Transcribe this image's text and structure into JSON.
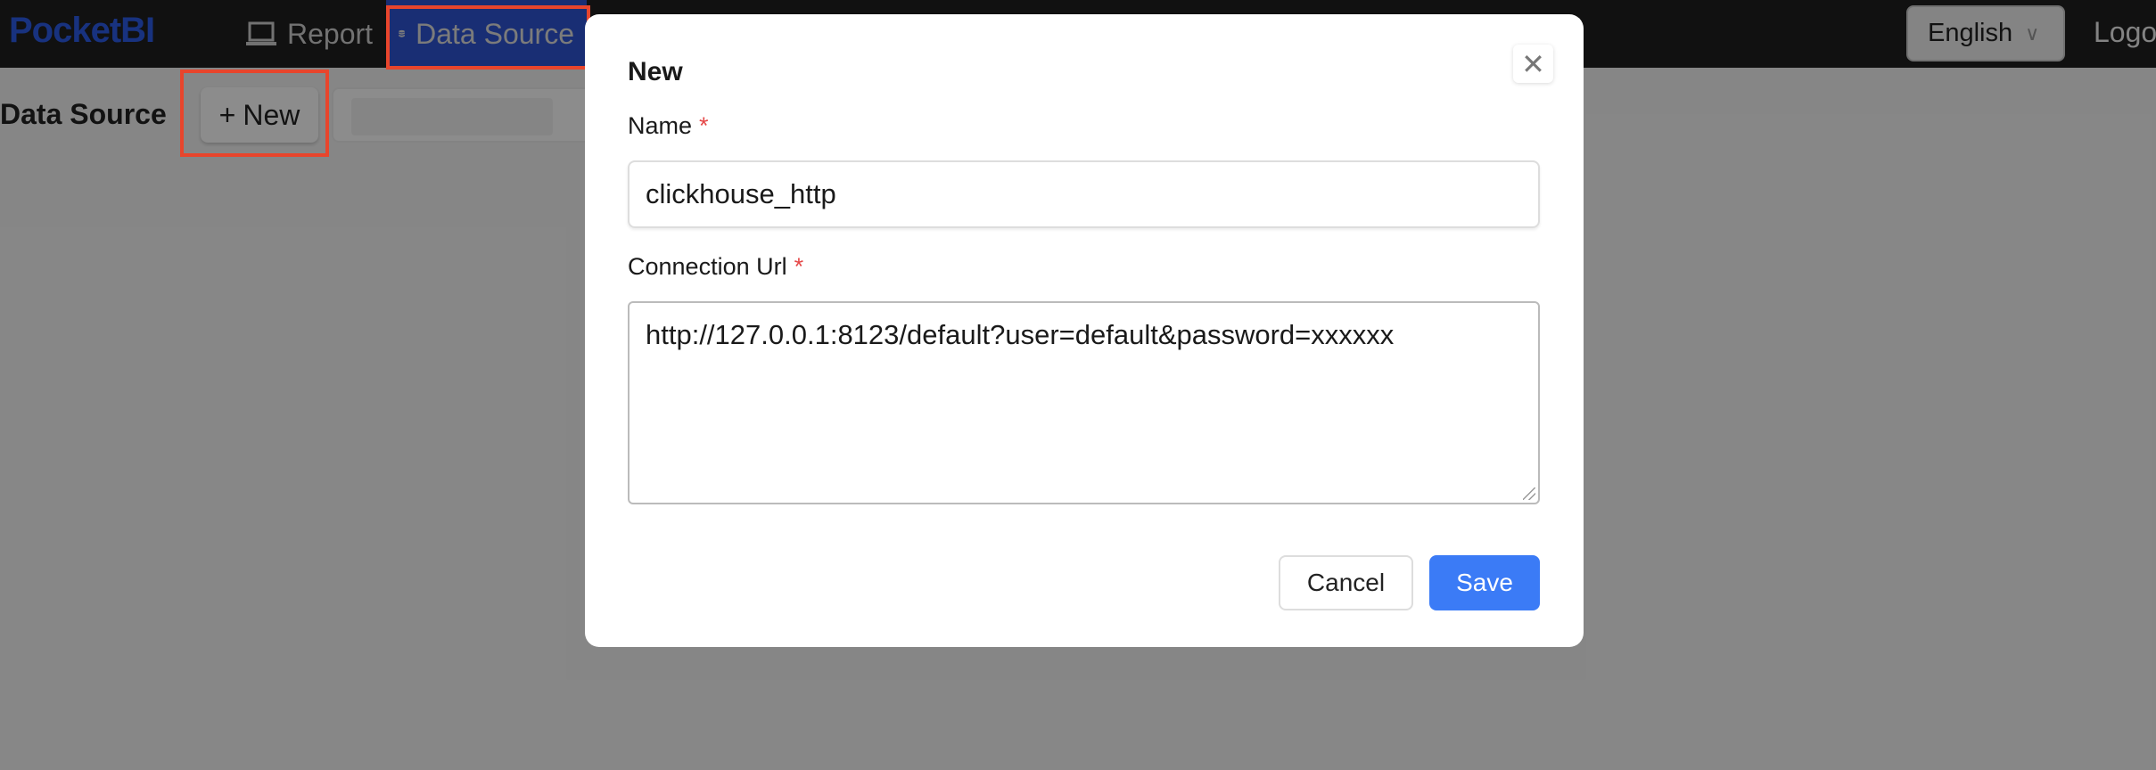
{
  "header": {
    "logo": "PocketBI",
    "nav": [
      {
        "label": "Report",
        "icon": "laptop-icon"
      },
      {
        "label": "Data Source",
        "icon": "database-icon"
      }
    ],
    "language": "English",
    "logout": "Logout"
  },
  "page": {
    "title": "Data Source",
    "new_button": "New"
  },
  "modal": {
    "title": "New",
    "name_label": "Name",
    "name_value": "clickhouse_http",
    "url_label": "Connection Url",
    "url_value": "http://127.0.0.1:8123/default?user=default&password=xxxxxx",
    "required_mark": "*",
    "cancel": "Cancel",
    "save": "Save"
  },
  "colors": {
    "highlight": "#e8452c",
    "primary": "#3b7bf6",
    "required": "#e54848"
  }
}
